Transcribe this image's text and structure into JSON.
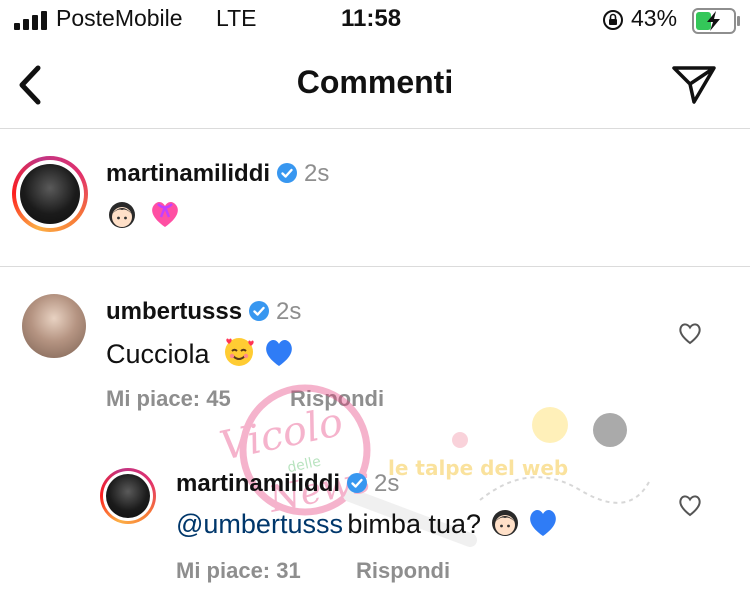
{
  "status_bar": {
    "carrier": "PosteMobile",
    "network": "LTE",
    "time": "11:58",
    "battery_percent": "43%",
    "battery_level": 0.43,
    "icons": [
      "signal-bars-icon",
      "orientation-lock-icon",
      "battery-charging-icon"
    ]
  },
  "header": {
    "title": "Commenti",
    "icons": [
      "back-chevron-icon",
      "send-paper-plane-icon"
    ]
  },
  "caption": {
    "username": "martinamiliddi",
    "verified": true,
    "timestamp": "2s",
    "emojis": [
      "girl-face-emoji",
      "heart-with-ribbon-emoji"
    ]
  },
  "comments": [
    {
      "username": "umbertusss",
      "verified": true,
      "timestamp": "2s",
      "text": "Cucciola",
      "emojis": [
        "smiling-face-with-hearts-emoji",
        "blue-heart-emoji"
      ],
      "likes_label": "Mi piace: 45",
      "reply_label": "Rispondi",
      "replies": [
        {
          "username": "martinamiliddi",
          "verified": true,
          "timestamp": "2s",
          "mention": "@umbertusss",
          "text": "bimba tua?",
          "emojis": [
            "girl-face-emoji",
            "blue-heart-emoji"
          ],
          "likes_label": "Mi piace: 31",
          "reply_label": "Rispondi"
        }
      ]
    }
  ],
  "colors": {
    "accent_link": "#00376b",
    "verified_blue": "#3897f0",
    "muted_text": "#8e8e8e",
    "divider": "#dbdbdb",
    "battery_green": "#34c759"
  },
  "watermark": {
    "text_1": "Vicolo",
    "text_2": "delle",
    "text_3": "News",
    "text_4": "le talpe del web"
  }
}
